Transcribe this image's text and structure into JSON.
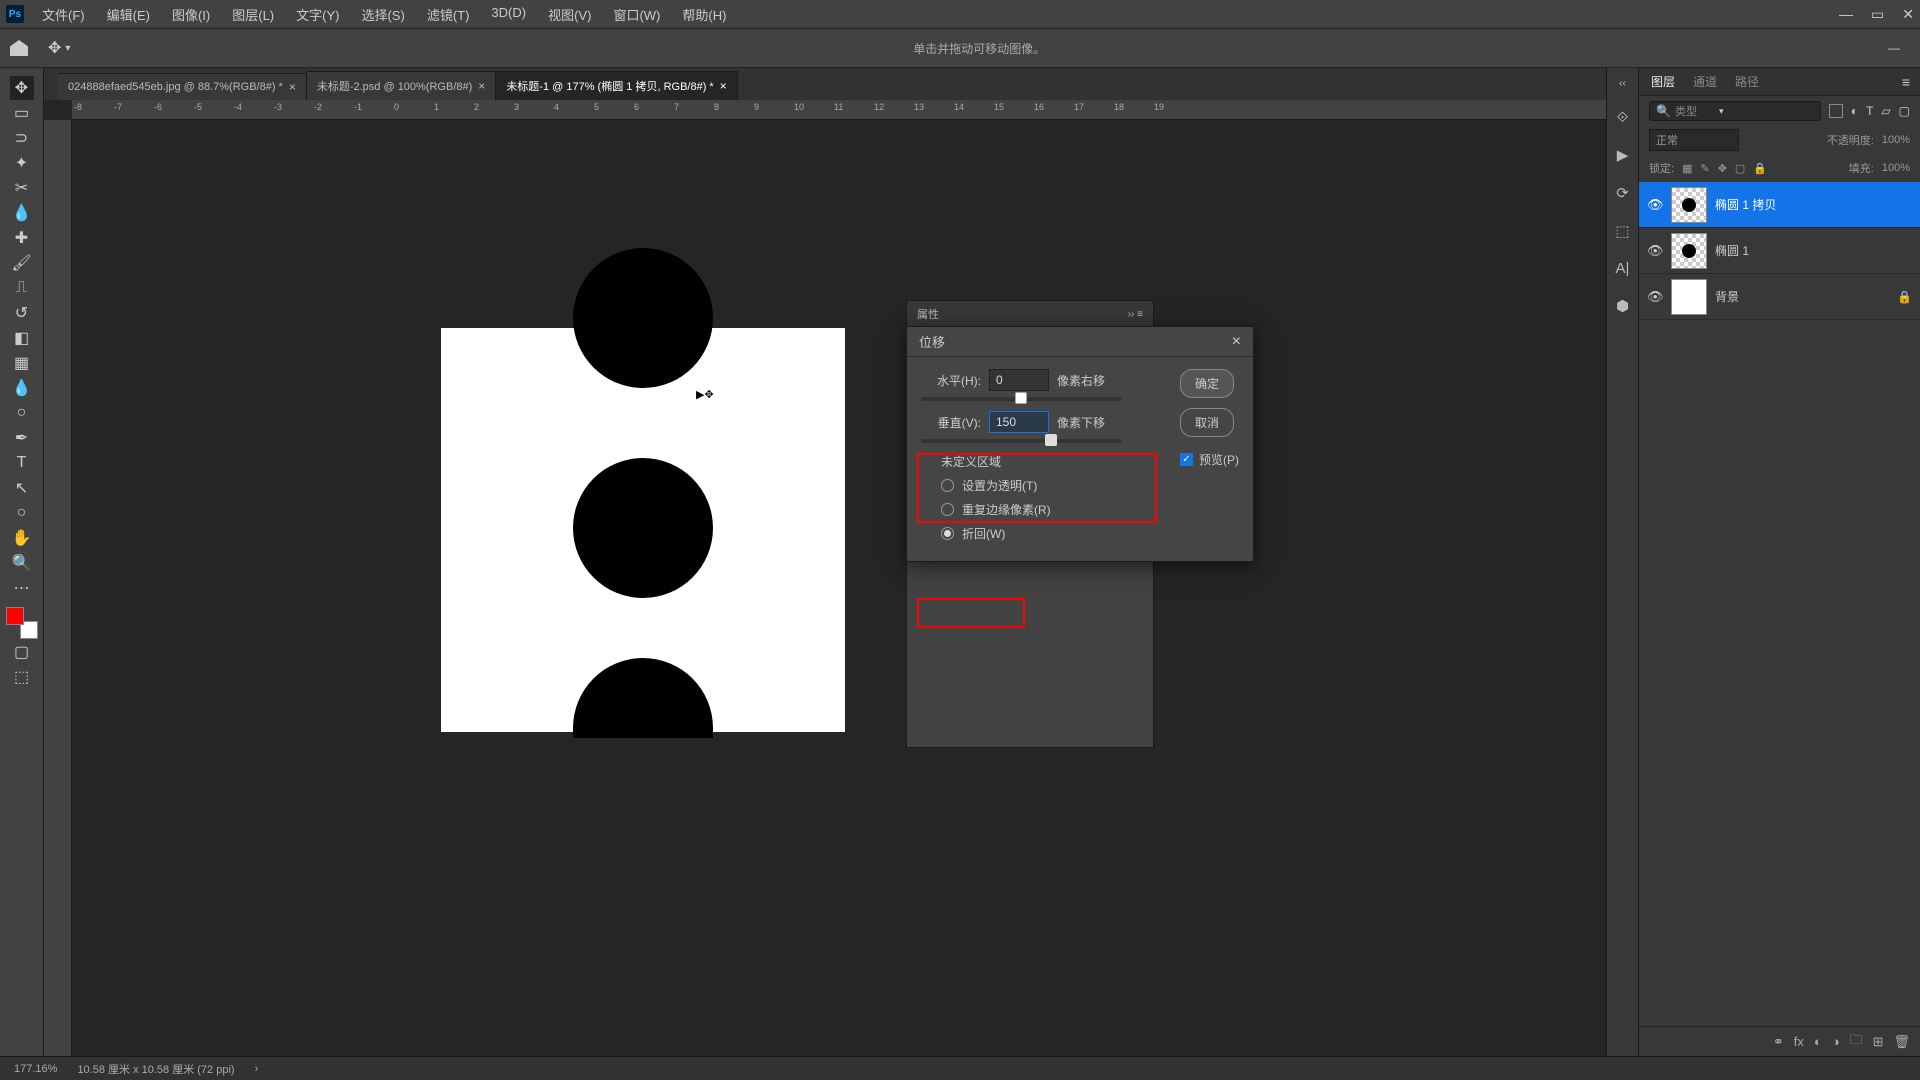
{
  "app": {
    "name": "Ps"
  },
  "menu": {
    "file": "文件(F)",
    "edit": "编辑(E)",
    "image": "图像(I)",
    "layer": "图层(L)",
    "text": "文字(Y)",
    "select": "选择(S)",
    "filter": "滤镜(T)",
    "threeD": "3D(D)",
    "view": "视图(V)",
    "window": "窗口(W)",
    "help": "帮助(H)"
  },
  "optbar": {
    "hint": "单击并拖动可移动图像。"
  },
  "tabs": [
    {
      "label": "024888efaed545eb.jpg @ 88.7%(RGB/8#) *",
      "active": false
    },
    {
      "label": "未标题-2.psd @ 100%(RGB/8#)",
      "active": false
    },
    {
      "label": "未标题-1 @ 177% (椭圆 1 拷贝, RGB/8#) *",
      "active": true
    }
  ],
  "ruler": [
    "-8",
    "-7",
    "-6",
    "-5",
    "-4",
    "-3",
    "-2",
    "-1",
    "0",
    "1",
    "2",
    "3",
    "4",
    "5",
    "6",
    "7",
    "8",
    "9",
    "10",
    "11",
    "12",
    "13",
    "14",
    "15",
    "16",
    "17",
    "18",
    "19"
  ],
  "prop_panel": {
    "title": "属性"
  },
  "dialog": {
    "title": "位移",
    "horizontal_label": "水平(H):",
    "horizontal_value": "0",
    "horizontal_unit": "像素右移",
    "vertical_label": "垂直(V):",
    "vertical_value": "150",
    "vertical_unit": "像素下移",
    "ok": "确定",
    "cancel": "取消",
    "preview": "预览(P)",
    "section": "未定义区域",
    "opt_transparent": "设置为透明(T)",
    "opt_repeat": "重复边缘像素(R)",
    "opt_wrap": "折回(W)"
  },
  "panels": {
    "layers": "图层",
    "channels": "通道",
    "paths": "路径",
    "kind": "类型",
    "blend": "正常",
    "opacity_label": "不透明度:",
    "opacity": "100%",
    "lock": "锁定:",
    "fill_label": "填充:",
    "fill": "100%"
  },
  "layers": [
    {
      "name": "椭圆 1 拷贝",
      "active": true,
      "type": "shape"
    },
    {
      "name": "椭圆 1",
      "active": false,
      "type": "shape"
    },
    {
      "name": "背景",
      "active": false,
      "type": "bg",
      "locked": true
    }
  ],
  "status": {
    "zoom": "177.16%",
    "doc": "10.58 厘米 x 10.58 厘米 (72 ppi)"
  }
}
